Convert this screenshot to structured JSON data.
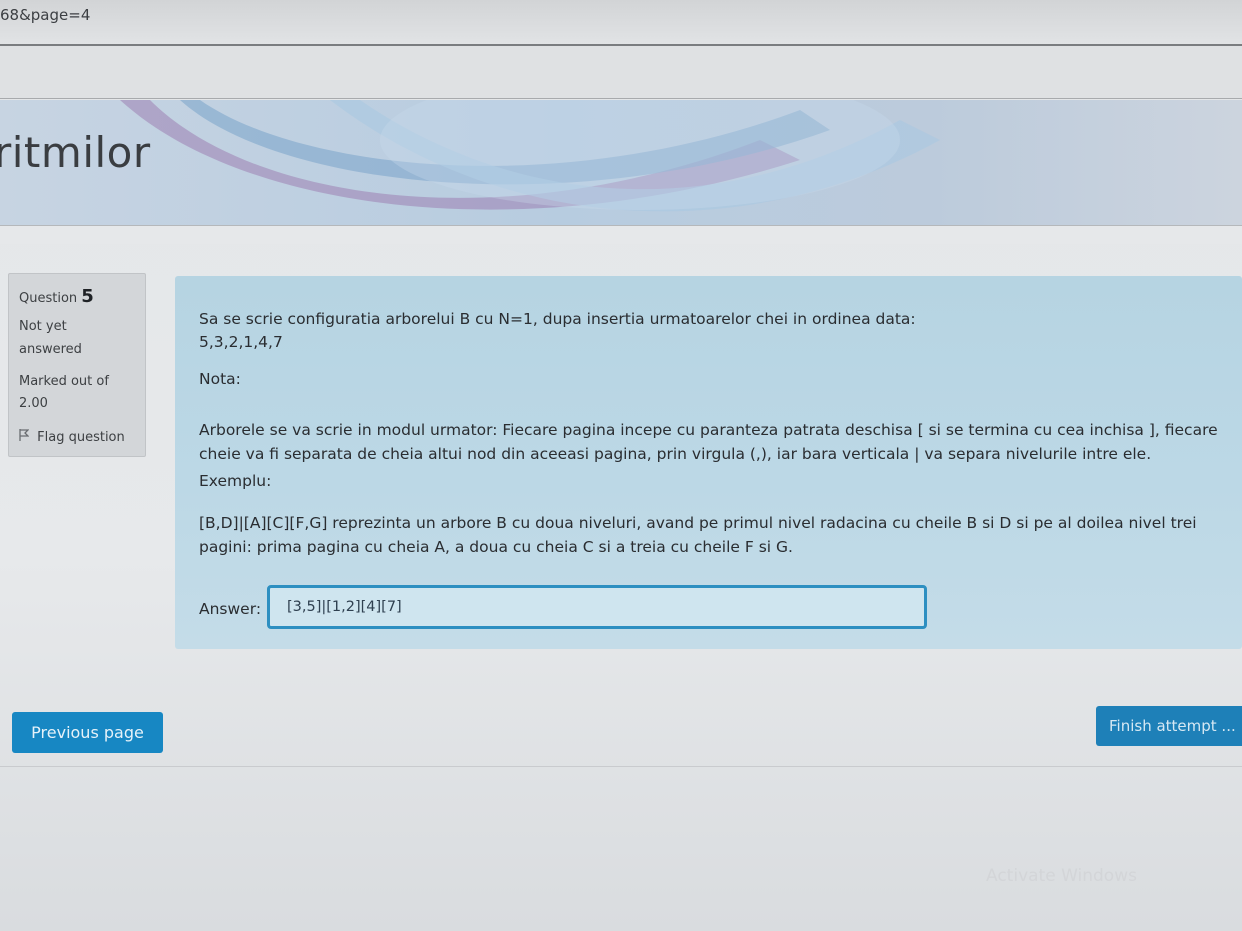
{
  "browser": {
    "url_fragment": "68&page=4"
  },
  "banner": {
    "title": "ritmilor"
  },
  "question_info": {
    "label": "Question",
    "number": "5",
    "state_line1": "Not yet",
    "state_line2": "answered",
    "marks_line1": "Marked out of",
    "marks_line2": "2.00",
    "flag_label": "Flag question",
    "flag_icon": "flag-icon"
  },
  "question": {
    "text_main": "Sa se scrie configuratia arborelui B cu N=1, dupa insertia urmatoarelor chei in ordinea data:",
    "keys": "5,3,2,1,4,7",
    "nota_label": "Nota:",
    "rule_line1": "Arborele se va scrie in modul urmator: Fiecare pagina incepe cu paranteza patrata deschisa [ si se termina cu cea inchisa ], fiecare",
    "rule_line2": "cheie va fi separata de cheia altui nod din aceeasi pagina, prin virgula (,), iar bara verticala | va separa nivelurile intre ele.",
    "example_label": "Exemplu:",
    "example_line1": "[B,D]|[A][C][F,G] reprezinta un arbore B cu doua niveluri, avand pe primul nivel radacina cu cheile B si D si pe al doilea nivel trei",
    "example_line2": "pagini: prima pagina cu cheia A, a doua cu cheia C si a treia cu cheile F si G."
  },
  "answer": {
    "label": "Answer:",
    "value": "[3,5]|[1,2][4][7]"
  },
  "navigation": {
    "previous_label": "Previous page",
    "finish_label": "Finish attempt ..."
  },
  "os": {
    "watermark": "Activate Windows"
  },
  "colors": {
    "question_bg": "#b6d4e2",
    "button_primary": "#1787c3",
    "input_border": "#2d8fc1"
  }
}
